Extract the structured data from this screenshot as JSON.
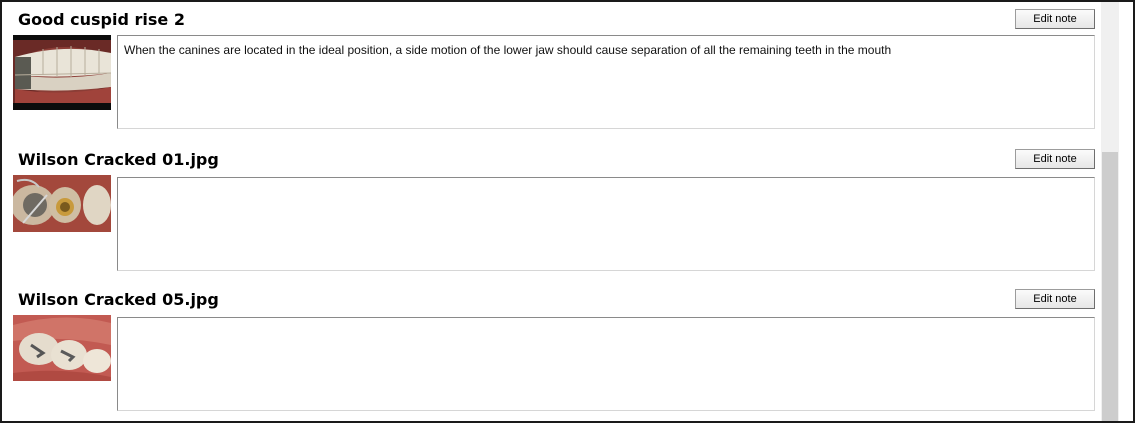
{
  "entries": [
    {
      "title": "Good cuspid rise 2",
      "edit_label": "Edit note",
      "note": "When the canines are located in the ideal position, a side motion of the lower jaw should cause separation of all the remaining teeth in the mouth",
      "thumbnail": "teeth-smile-photo"
    },
    {
      "title": "Wilson Cracked 01.jpg",
      "edit_label": "Edit note",
      "note": "",
      "thumbnail": "cracked-molar-photo"
    },
    {
      "title": "Wilson Cracked 05.jpg",
      "edit_label": "Edit note",
      "note": "",
      "thumbnail": "amalgam-fillings-photo"
    }
  ]
}
